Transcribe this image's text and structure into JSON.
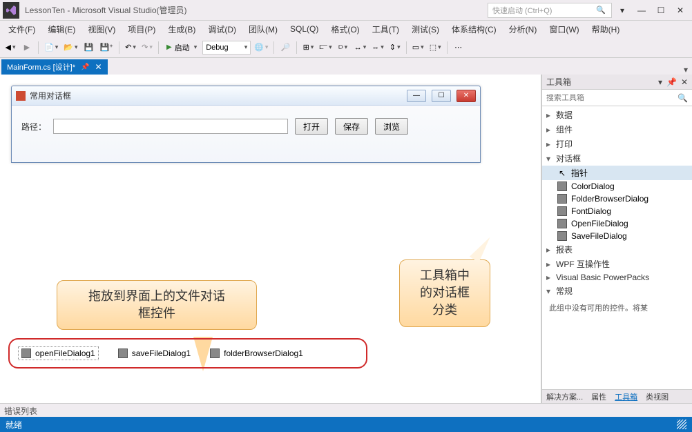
{
  "window": {
    "title": "LessonTen - Microsoft Visual Studio(管理员)",
    "quick_launch_placeholder": "快速启动 (Ctrl+Q)"
  },
  "menus": [
    "文件(F)",
    "编辑(E)",
    "视图(V)",
    "项目(P)",
    "生成(B)",
    "调试(D)",
    "团队(M)",
    "SQL(Q)",
    "格式(O)",
    "工具(T)",
    "测试(S)",
    "体系结构(C)",
    "分析(N)",
    "窗口(W)",
    "帮助(H)"
  ],
  "toolbar": {
    "start_label": "启动",
    "config": "Debug"
  },
  "document_tab": {
    "label": "MainForm.cs [设计]*"
  },
  "form": {
    "title": "常用对话框",
    "path_label": "路径：",
    "btn_open": "打开",
    "btn_save": "保存",
    "btn_browse": "浏览"
  },
  "tray": {
    "items": [
      "openFileDialog1",
      "saveFileDialog1",
      "folderBrowserDialog1"
    ]
  },
  "callouts": {
    "c1_l1": "拖放到界面上的文件对话",
    "c1_l2": "框控件",
    "c2_l1": "工具箱中",
    "c2_l2": "的对话框",
    "c2_l3": "分类"
  },
  "toolbox": {
    "title": "工具箱",
    "search_placeholder": "搜索工具箱",
    "categories": {
      "data": "数据",
      "components": "组件",
      "printing": "打印",
      "dialogs": "对话框",
      "reports": "报表",
      "wpf": "WPF 互操作性",
      "vbpp": "Visual Basic PowerPacks",
      "general": "常规"
    },
    "dialog_items": [
      "指针",
      "ColorDialog",
      "FolderBrowserDialog",
      "FontDialog",
      "OpenFileDialog",
      "SaveFileDialog"
    ],
    "empty_text": "此组中没有可用的控件。将某",
    "tabs": [
      "解决方案...",
      "属性",
      "工具箱",
      "类视图"
    ]
  },
  "errorlist_label": "错误列表",
  "status": "就绪"
}
